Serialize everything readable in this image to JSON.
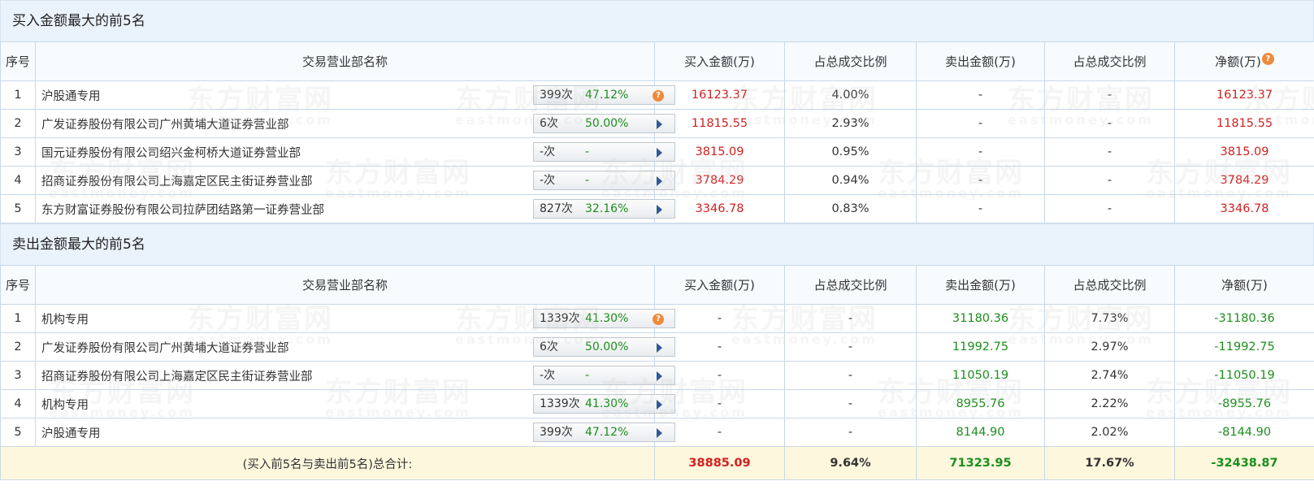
{
  "buy_section": {
    "title": "买入金额最大的前5名",
    "headers": [
      "序号",
      "交易营业部名称",
      "买入金额(万)",
      "占总成交比例",
      "卖出金额(万)",
      "占总成交比例",
      "净额(万)"
    ],
    "rows": [
      {
        "no": "1",
        "name": "沪股通专用",
        "times": "399次",
        "pct": "47.12%",
        "icon": "question-icon",
        "buy": "16123.37",
        "buy_ratio": "4.00%",
        "sell": "-",
        "sell_ratio": "-",
        "net": "16123.37"
      },
      {
        "no": "2",
        "name": "广发证券股份有限公司广州黄埔大道证券营业部",
        "times": "6次",
        "pct": "50.00%",
        "icon": "play-arrow-icon",
        "buy": "11815.55",
        "buy_ratio": "2.93%",
        "sell": "-",
        "sell_ratio": "-",
        "net": "11815.55"
      },
      {
        "no": "3",
        "name": "国元证券股份有限公司绍兴金柯桥大道证券营业部",
        "times": "-次",
        "pct": "-",
        "icon": "play-arrow-icon",
        "buy": "3815.09",
        "buy_ratio": "0.95%",
        "sell": "-",
        "sell_ratio": "-",
        "net": "3815.09"
      },
      {
        "no": "4",
        "name": "招商证券股份有限公司上海嘉定区民主街证券营业部",
        "times": "-次",
        "pct": "-",
        "icon": "play-arrow-icon",
        "buy": "3784.29",
        "buy_ratio": "0.94%",
        "sell": "-",
        "sell_ratio": "-",
        "net": "3784.29"
      },
      {
        "no": "5",
        "name": "东方财富证券股份有限公司拉萨团结路第一证券营业部",
        "times": "827次",
        "pct": "32.16%",
        "icon": "play-arrow-icon",
        "buy": "3346.78",
        "buy_ratio": "0.83%",
        "sell": "-",
        "sell_ratio": "-",
        "net": "3346.78"
      }
    ]
  },
  "sell_section": {
    "title": "卖出金额最大的前5名",
    "headers": [
      "序号",
      "交易营业部名称",
      "买入金额(万)",
      "占总成交比例",
      "卖出金额(万)",
      "占总成交比例",
      "净额(万)"
    ],
    "rows": [
      {
        "no": "1",
        "name": "机构专用",
        "times": "1339次",
        "pct": "41.30%",
        "icon": "question-icon",
        "buy": "-",
        "buy_ratio": "-",
        "sell": "31180.36",
        "sell_ratio": "7.73%",
        "net": "-31180.36"
      },
      {
        "no": "2",
        "name": "广发证券股份有限公司广州黄埔大道证券营业部",
        "times": "6次",
        "pct": "50.00%",
        "icon": "play-arrow-icon",
        "buy": "-",
        "buy_ratio": "-",
        "sell": "11992.75",
        "sell_ratio": "2.97%",
        "net": "-11992.75"
      },
      {
        "no": "3",
        "name": "招商证券股份有限公司上海嘉定区民主街证券营业部",
        "times": "-次",
        "pct": "-",
        "icon": "play-arrow-icon",
        "buy": "-",
        "buy_ratio": "-",
        "sell": "11050.19",
        "sell_ratio": "2.74%",
        "net": "-11050.19"
      },
      {
        "no": "4",
        "name": "机构专用",
        "times": "1339次",
        "pct": "41.30%",
        "icon": "play-arrow-icon",
        "buy": "-",
        "buy_ratio": "-",
        "sell": "8955.76",
        "sell_ratio": "2.22%",
        "net": "-8955.76"
      },
      {
        "no": "5",
        "name": "沪股通专用",
        "times": "399次",
        "pct": "47.12%",
        "icon": "play-arrow-icon",
        "buy": "-",
        "buy_ratio": "-",
        "sell": "8144.90",
        "sell_ratio": "2.02%",
        "net": "-8144.90"
      }
    ]
  },
  "total": {
    "label": "(买入前5名与卖出前5名)总合计:",
    "buy": "38885.09",
    "buy_ratio": "9.64%",
    "sell": "71323.95",
    "sell_ratio": "17.67%",
    "net": "-32438.87"
  },
  "watermark": {
    "cn": "东方财富网",
    "en": "eastmoney.com"
  },
  "colors": {
    "positive": "#d11f1f",
    "negative": "#1c8e1c",
    "header_bg": "#eaf3fb",
    "total_bg": "#fdf7dd",
    "help_icon": "#ef8a3c"
  }
}
